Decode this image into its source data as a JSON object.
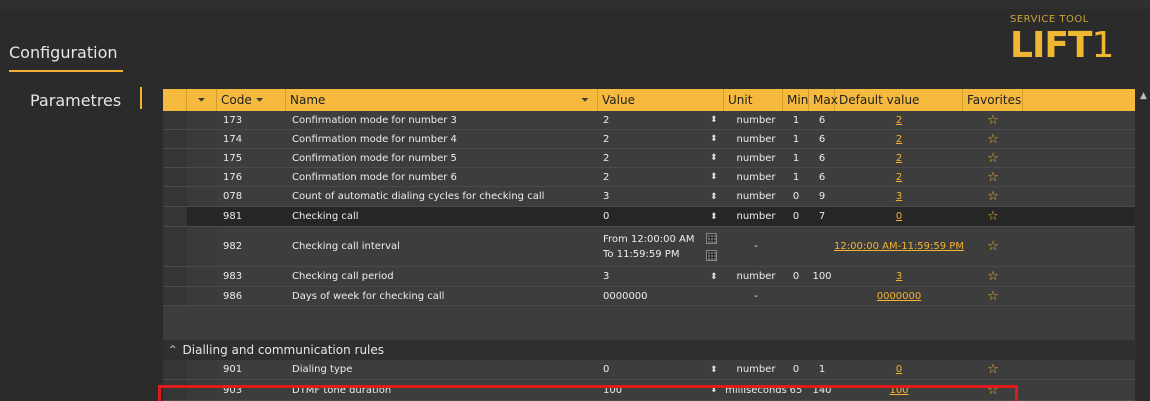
{
  "app": {
    "title": "Configuration",
    "brand_subtitle": "SERVICE TOOL",
    "brand_logo": "LIFT",
    "brand_digit": "1"
  },
  "sidebar": {
    "items": [
      {
        "label": "Parametres"
      }
    ]
  },
  "grid": {
    "headers": {
      "code": "Code",
      "name": "Name",
      "value": "Value",
      "unit": "Unit",
      "min": "Min",
      "max": "Max",
      "default": "Default value",
      "favorites": "Favorites"
    },
    "rows": [
      {
        "code": "173",
        "name": "Confirmation mode for number 3",
        "value": "2",
        "unit": "number",
        "min": "1",
        "max": "6",
        "default": "2"
      },
      {
        "code": "174",
        "name": "Confirmation mode for number 4",
        "value": "2",
        "unit": "number",
        "min": "1",
        "max": "6",
        "default": "2"
      },
      {
        "code": "175",
        "name": "Confirmation mode for number 5",
        "value": "2",
        "unit": "number",
        "min": "1",
        "max": "6",
        "default": "2"
      },
      {
        "code": "176",
        "name": "Confirmation mode for number 6",
        "value": "2",
        "unit": "number",
        "min": "1",
        "max": "6",
        "default": "2"
      },
      {
        "code": "078",
        "name": "Count of automatic dialing cycles for checking call",
        "value": "3",
        "unit": "number",
        "min": "0",
        "max": "9",
        "default": "3"
      },
      {
        "code": "981",
        "name": "Checking call",
        "value": "0",
        "unit": "number",
        "min": "0",
        "max": "7",
        "default": "0"
      },
      {
        "code": "982",
        "name": "Checking call interval",
        "value_from": "From 12:00:00 AM",
        "value_to": "To    11:59:59 PM",
        "unit": "-",
        "min": "",
        "max": "",
        "default": "12:00:00 AM-11:59:59 PM"
      },
      {
        "code": "983",
        "name": "Checking call period",
        "value": "3",
        "unit": "number",
        "min": "0",
        "max": "100",
        "default": "3"
      },
      {
        "code": "986",
        "name": "Days of week for checking call",
        "value": "0000000",
        "unit": "-",
        "min": "",
        "max": "",
        "default": "0000000"
      }
    ],
    "group": {
      "label": "Dialling and communication rules"
    },
    "group_rows": [
      {
        "code": "901",
        "name": "Dialing type",
        "value": "0",
        "unit": "number",
        "min": "0",
        "max": "1",
        "default": "0"
      },
      {
        "code": "903",
        "name": "DTMF tone duration",
        "value": "100",
        "unit": "milliseconds",
        "min": "65",
        "max": "140",
        "default": "100"
      }
    ]
  },
  "icons": {
    "filter": "filter-icon",
    "spinner": "spinner-icon",
    "favorite": "star-icon",
    "calendar": "calendar-icon",
    "collapse": "chevron-up-icon"
  },
  "colors": {
    "accent": "#f5b93d",
    "highlight_border": "#e01b1b",
    "background": "#2b2b2b",
    "grid_row": "#3d3d3d",
    "selected_row": "#262626"
  }
}
